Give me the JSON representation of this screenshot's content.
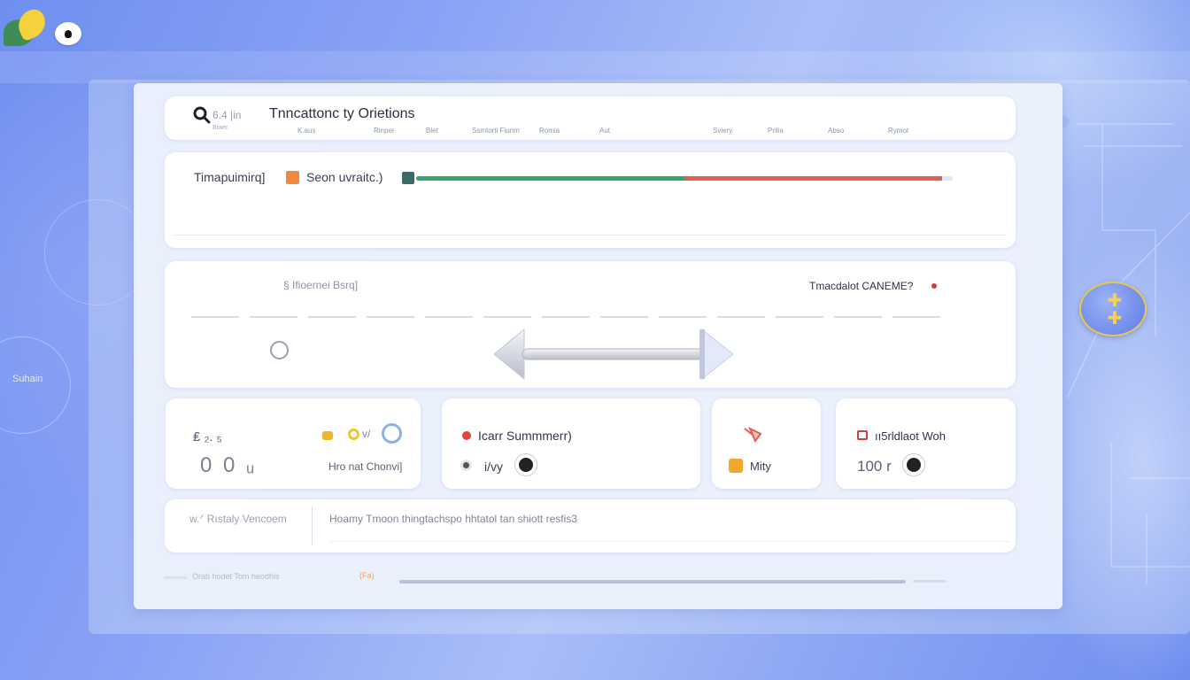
{
  "header": {
    "search_meta": "6.4 |in",
    "search_sub": "Biwer",
    "title": "Tnncattonc ty Orietions",
    "columns": [
      "K.aus",
      "Rinper",
      "Blet",
      "Ssmtorti Fiunm",
      "Romia",
      "Aut",
      "Sviery",
      "Prilia",
      "Abso",
      "Rymot"
    ]
  },
  "timeline": {
    "label": "Timapuimirq]",
    "legend": "Seon uvraitc.)",
    "progress_green": 0.5,
    "progress_red": 0.5,
    "colors": {
      "green": "#35a569",
      "red": "#e25d4f",
      "orange": "#f08a3a"
    }
  },
  "range": {
    "left_label": "§ Ifioernei Bsrq]",
    "right_label": "Tmacdalot CANEME?",
    "handle_icon": "double-arrow-slider-icon"
  },
  "metrics": {
    "m1": {
      "label": "₤ ₂. ₅",
      "value": "0 0 ᵤ",
      "sub": "Hro nat Chonvi]",
      "v": "v/"
    },
    "m2": {
      "label": "Icarr Summmerr)",
      "sub": "i/vy"
    },
    "m3": {
      "icon": "hatchet-icon",
      "label": "Mity"
    },
    "m4": {
      "label": "ıı5rldlaot Woh",
      "value": "100 r"
    }
  },
  "history": {
    "label": "w.ᐟ Rıstaly Vencoem",
    "text": "Hoamy Tmoon thingtachspo hhtatol tan shiott resfis3"
  },
  "footer": {
    "label": "Orab hodet Tom heodhis",
    "badge": "(Fa)"
  },
  "side": {
    "tag": "Suhain"
  }
}
